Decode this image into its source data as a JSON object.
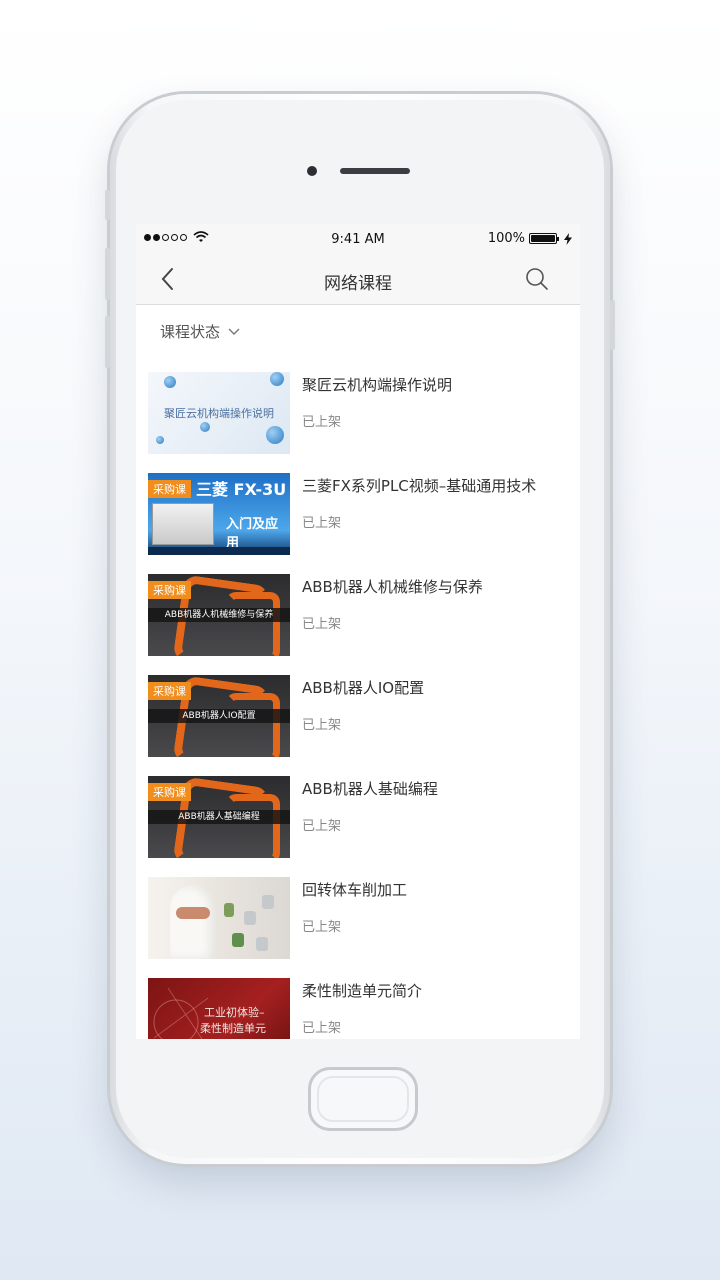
{
  "status_bar": {
    "time": "9:41 AM",
    "battery": "100%"
  },
  "nav": {
    "title": "网络课程"
  },
  "filter": {
    "label": "课程状态"
  },
  "courses": [
    {
      "title": "聚匠云机构端操作说明",
      "status": "已上架",
      "thumb_text": "聚匠云机构端操作说明"
    },
    {
      "title": "三菱FX系列PLC视频–基础通用技术",
      "status": "已上架",
      "badge": "采购课",
      "thumb_text": "三菱 FX-3U",
      "thumb_sub": "入门及应用"
    },
    {
      "title": "ABB机器人机械维修与保养",
      "status": "已上架",
      "badge": "采购课",
      "thumb_text": "ABB机器人机械维修与保养"
    },
    {
      "title": "ABB机器人IO配置",
      "status": "已上架",
      "badge": "采购课",
      "thumb_text": "ABB机器人IO配置"
    },
    {
      "title": "ABB机器人基础编程",
      "status": "已上架",
      "badge": "采购课",
      "thumb_text": "ABB机器人基础编程"
    },
    {
      "title": "回转体车削加工",
      "status": "已上架"
    },
    {
      "title": "柔性制造单元简介",
      "status": "已上架",
      "thumb_text": "工业初体验–",
      "thumb_sub": "柔性制造单元"
    }
  ]
}
